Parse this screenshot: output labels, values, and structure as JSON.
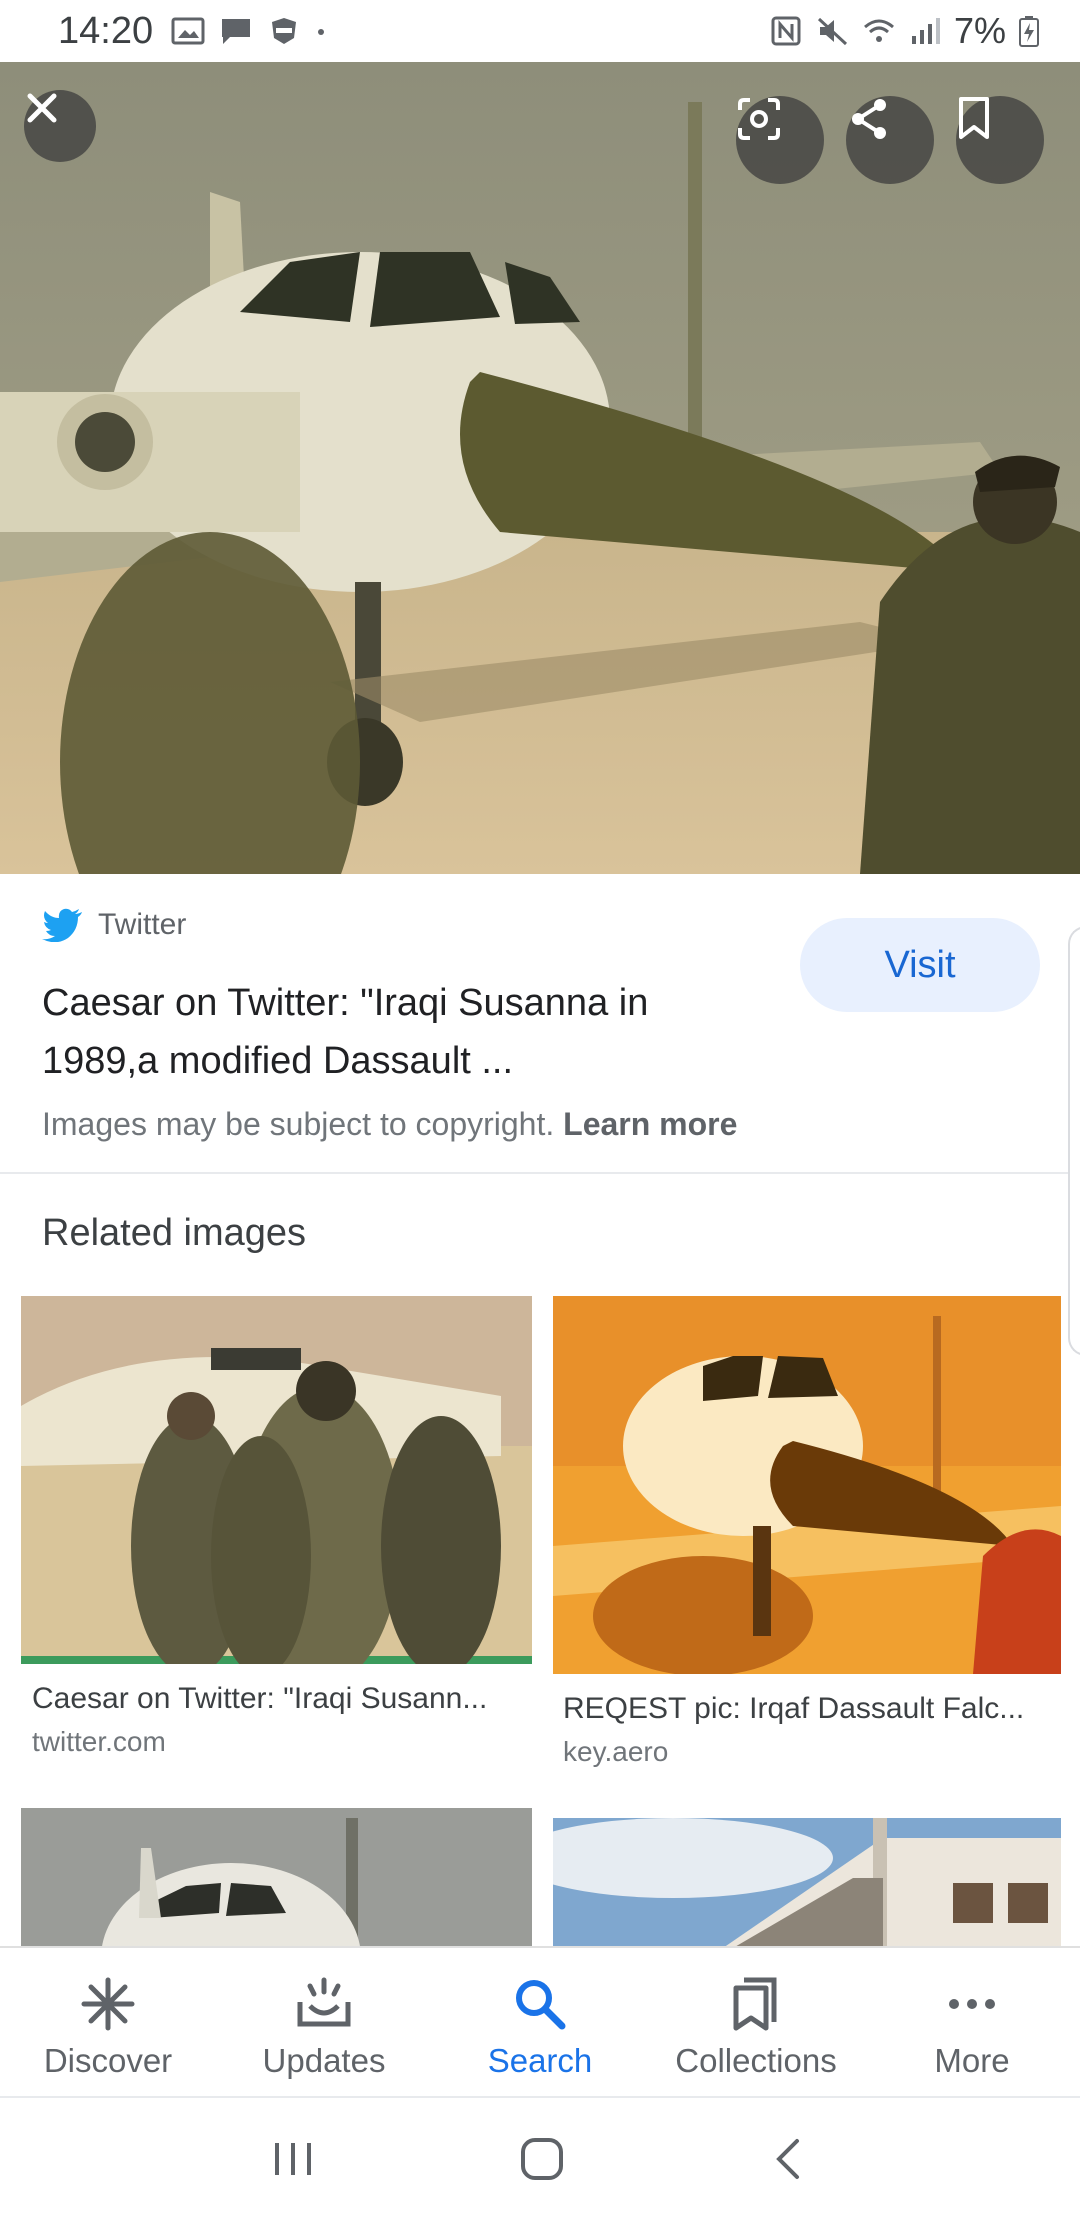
{
  "status_bar": {
    "time": "14:20",
    "battery": "7%",
    "left_icons": [
      "gallery-icon",
      "chat-icon",
      "badge-icon",
      "dot-icon"
    ],
    "right_icons": [
      "nfc-icon",
      "mute-icon",
      "wifi-icon",
      "signal-icon",
      "battery-charging-icon"
    ]
  },
  "hero": {
    "actions": [
      "close-icon",
      "lens-icon",
      "share-icon",
      "bookmark-icon"
    ]
  },
  "source": {
    "site_name": "Twitter",
    "title": "Caesar on Twitter: \"Iraqi Susanna in 1989,a modified Dassault ...",
    "visit_label": "Visit",
    "copyright_text": "Images may be subject to copyright. ",
    "learn_more": "Learn more"
  },
  "related": {
    "heading": "Related images",
    "items": [
      {
        "caption": "Caesar on Twitter: \"Iraqi Susann...",
        "source": "twitter.com"
      },
      {
        "caption": "REQEST pic: Irqaf Dassault Falc...",
        "source": "key.aero"
      }
    ]
  },
  "bottom_nav": {
    "items": [
      {
        "label": "Discover",
        "icon": "discover-icon"
      },
      {
        "label": "Updates",
        "icon": "updates-icon"
      },
      {
        "label": "Search",
        "icon": "search-icon"
      },
      {
        "label": "Collections",
        "icon": "collections-icon"
      },
      {
        "label": "More",
        "icon": "more-icon"
      }
    ],
    "active": "Search"
  },
  "colors": {
    "accent": "#1a73e8",
    "visit_bg": "#e8f0fe",
    "twitter_blue": "#1da1f2"
  }
}
